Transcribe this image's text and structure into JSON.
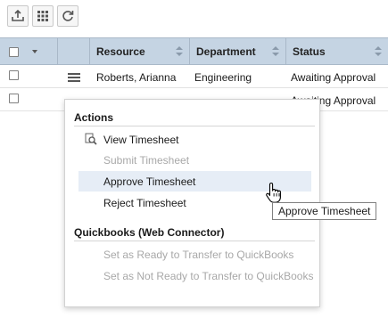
{
  "toolbar": {
    "buttons": [
      {
        "icon": "export-icon"
      },
      {
        "icon": "grid-columns-icon"
      },
      {
        "icon": "refresh-icon"
      }
    ]
  },
  "grid": {
    "columns": [
      "Resource",
      "Department",
      "Status"
    ],
    "rows": [
      {
        "resource": "Roberts, Arianna",
        "department": "Engineering",
        "status": "Awaiting Approval"
      },
      {
        "resource": "",
        "department": "",
        "status": "Awaiting Approval"
      }
    ]
  },
  "menu": {
    "actions_title": "Actions",
    "actions": [
      {
        "label": "View Timesheet",
        "disabled": false,
        "icon": "view-timesheet-icon"
      },
      {
        "label": "Submit Timesheet",
        "disabled": true
      },
      {
        "label": "Approve Timesheet",
        "disabled": false,
        "hover": true
      },
      {
        "label": "Reject Timesheet",
        "disabled": false
      }
    ],
    "qb_title": "Quickbooks (Web Connector)",
    "qb_items": [
      {
        "label": "Set as Ready to Transfer to QuickBooks",
        "disabled": true
      },
      {
        "label": "Set as Not Ready to Transfer to QuickBooks",
        "disabled": true
      }
    ]
  },
  "tooltip": "Approve Timesheet",
  "colors": {
    "header_bg": "#c5d4e3",
    "hover_bg": "#e6edf6",
    "disabled_text": "#a8a8a8"
  }
}
